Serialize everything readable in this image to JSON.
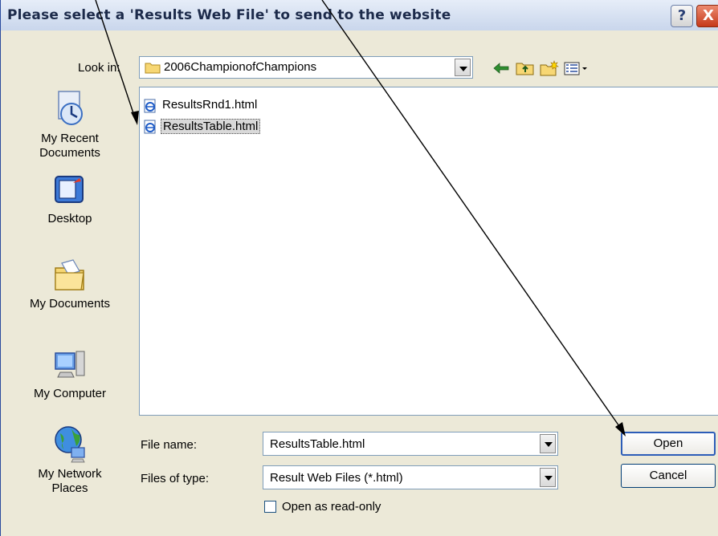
{
  "dialog": {
    "title": "Please select a 'Results Web File' to send to the website",
    "help_label": "?",
    "close_label": "X"
  },
  "look_in": {
    "label": "Look in:",
    "value": "2006ChampionofChampions"
  },
  "places": [
    {
      "label": "My Recent\nDocuments",
      "icon": "recent-documents-icon"
    },
    {
      "label": "Desktop",
      "icon": "desktop-icon"
    },
    {
      "label": "My Documents",
      "icon": "my-documents-icon"
    },
    {
      "label": "My Computer",
      "icon": "my-computer-icon"
    },
    {
      "label": "My Network\nPlaces",
      "icon": "network-places-icon"
    }
  ],
  "files": [
    {
      "name": "ResultsRnd1.html",
      "selected": false
    },
    {
      "name": "ResultsTable.html",
      "selected": true
    }
  ],
  "file_name": {
    "label": "File name:",
    "value": "ResultsTable.html"
  },
  "file_type": {
    "label": "Files of type:",
    "value": "Result Web Files (*.html)"
  },
  "read_only": {
    "label": "Open as read-only"
  },
  "buttons": {
    "open": "Open",
    "cancel": "Cancel"
  },
  "colors": {
    "accent": "#2c5db8",
    "window_bg": "#ece9d8",
    "close_red": "#c6391b"
  }
}
